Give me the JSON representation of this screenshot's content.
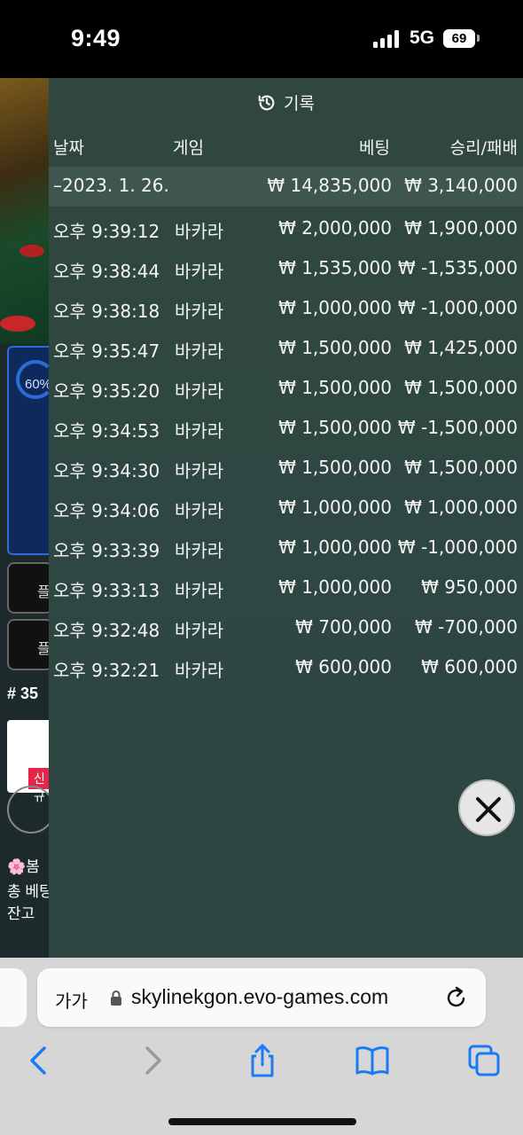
{
  "status_bar": {
    "time": "9:49",
    "network": "5G",
    "battery": "69"
  },
  "background_game": {
    "progress_label": "60%",
    "button_label_1": "플",
    "button_label_2": "플",
    "round_label": "# 35",
    "new_tag": "신규",
    "bottom_line_1": "🌸봄",
    "bottom_line_2": "총 베팅",
    "bottom_line_3": "잔고"
  },
  "history": {
    "title": "기록",
    "columns": {
      "date": "날짜",
      "game": "게임",
      "bet": "베팅",
      "result": "승리/패배"
    },
    "summary": {
      "date": "–2023. 1. 26.",
      "bet": "₩ 14,835,000",
      "result": "₩ 3,140,000"
    },
    "rows": [
      {
        "time": "오후 9:39:12",
        "game": "바카라",
        "bet": "₩ 2,000,000",
        "result": "₩ 1,900,000"
      },
      {
        "time": "오후 9:38:44",
        "game": "바카라",
        "bet": "₩ 1,535,000",
        "result": "₩ -1,535,000"
      },
      {
        "time": "오후 9:38:18",
        "game": "바카라",
        "bet": "₩ 1,000,000",
        "result": "₩ -1,000,000"
      },
      {
        "time": "오후 9:35:47",
        "game": "바카라",
        "bet": "₩ 1,500,000",
        "result": "₩ 1,425,000"
      },
      {
        "time": "오후 9:35:20",
        "game": "바카라",
        "bet": "₩ 1,500,000",
        "result": "₩ 1,500,000"
      },
      {
        "time": "오후 9:34:53",
        "game": "바카라",
        "bet": "₩ 1,500,000",
        "result": "₩ -1,500,000"
      },
      {
        "time": "오후 9:34:30",
        "game": "바카라",
        "bet": "₩ 1,500,000",
        "result": "₩ 1,500,000"
      },
      {
        "time": "오후 9:34:06",
        "game": "바카라",
        "bet": "₩ 1,000,000",
        "result": "₩ 1,000,000"
      },
      {
        "time": "오후 9:33:39",
        "game": "바카라",
        "bet": "₩ 1,000,000",
        "result": "₩ -1,000,000"
      },
      {
        "time": "오후 9:33:13",
        "game": "바카라",
        "bet": "₩ 1,000,000",
        "result": "₩ 950,000"
      },
      {
        "time": "오후 9:32:48",
        "game": "바카라",
        "bet": "₩ 700,000",
        "result": "₩ -700,000"
      },
      {
        "time": "오후 9:32:21",
        "game": "바카라",
        "bet": "₩ 600,000",
        "result": "₩ 600,000"
      }
    ]
  },
  "browser": {
    "text_size_label": "가가",
    "url": "skylinekgon.evo-games.com"
  },
  "colors": {
    "overlay_bg": "#2f4742",
    "summary_row_bg": "#3e5550",
    "accent_blue": "#2c6cd6",
    "ios_blue": "#1a7cf5"
  }
}
